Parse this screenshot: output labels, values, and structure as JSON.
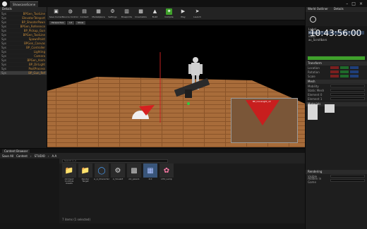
{
  "menubar": {
    "tab_label": "ShowcaseScene",
    "win_controls": [
      "–",
      "□",
      "×"
    ]
  },
  "left_panel": {
    "title": "Details",
    "rows": [
      {
        "k": "Sys",
        "v": "BPGen_ToolLine"
      },
      {
        "k": "Sys",
        "v": "ElevatorTeleport"
      },
      {
        "k": "Sys",
        "v": "BP_ShooterPawn"
      },
      {
        "k": "Sys",
        "v": "BPGen_Reference"
      },
      {
        "k": "Sys",
        "v": "BP_Pickup_Gun"
      },
      {
        "k": "Sys",
        "v": "BPGen_ToolLine"
      },
      {
        "k": "Sys",
        "v": "SpawnPoint"
      },
      {
        "k": "Sys",
        "v": "BPGen_Canvas"
      },
      {
        "k": "Sys",
        "v": "BP_Controller"
      },
      {
        "k": "Sys",
        "v": "Lighting"
      },
      {
        "k": "Sys",
        "v": "Camera"
      },
      {
        "k": "Sys",
        "v": "BPGen_Anim"
      },
      {
        "k": "Sys",
        "v": "BP_DirLight"
      },
      {
        "k": "Sys",
        "v": "PostProcess"
      },
      {
        "k": "Sys",
        "v": "BP_Gun_Ref"
      }
    ]
  },
  "toolbar": {
    "buttons": [
      {
        "icon": "save-icon",
        "glyph": "▣",
        "label": "Save Current"
      },
      {
        "icon": "source-control-icon",
        "glyph": "◍",
        "label": "Source Control"
      },
      {
        "icon": "content-icon",
        "glyph": "▤",
        "label": "Content"
      },
      {
        "icon": "marketplace-icon",
        "glyph": "▦",
        "label": "Marketplace"
      },
      {
        "icon": "settings-icon",
        "glyph": "⚙",
        "label": "Settings"
      },
      {
        "icon": "blueprints-icon",
        "glyph": "▥",
        "label": "Blueprints"
      },
      {
        "icon": "cinematics-icon",
        "glyph": "▩",
        "label": "Cinematics"
      },
      {
        "icon": "build-icon",
        "glyph": "▲",
        "label": "Build"
      },
      {
        "icon": "compile-icon",
        "glyph": "✦",
        "label": "Compile"
      },
      {
        "icon": "play-icon",
        "glyph": "▶",
        "label": "Play"
      },
      {
        "icon": "launch-icon",
        "glyph": "➤",
        "label": "Launch"
      }
    ]
  },
  "viewport": {
    "tabs": [
      "Perspective",
      "Lit",
      "Show"
    ],
    "inset_label": "BP_ConeLight_v2"
  },
  "right_panel": {
    "tabs": [
      "World Outliner",
      "Details"
    ],
    "clock": "10:43:56:00",
    "outliner": [
      "Label",
      "Material",
      "ideal",
      "ac_Scrollbars"
    ],
    "sections": [
      "Transform",
      "Mesh",
      "Materials",
      "Rendering"
    ],
    "props": [
      {
        "k": "Location"
      },
      {
        "k": "Rotation"
      },
      {
        "k": "Scale"
      },
      {
        "k": "Mobility"
      },
      {
        "k": "Static Mesh"
      },
      {
        "k": "Element 0"
      },
      {
        "k": "Element 1"
      },
      {
        "k": "Visible"
      },
      {
        "k": "Hidden in Game"
      }
    ]
  },
  "content_browser": {
    "tab": "Content Browser",
    "save_all": "Save All",
    "path": [
      "Content",
      "STUDIO",
      "A.A"
    ],
    "search_placeholder": "Search A_A",
    "assets": [
      {
        "name": "A4 Input Controls Assets",
        "glyph": "📁",
        "color": "#8b8b8b"
      },
      {
        "name": "Render Target",
        "glyph": "📁",
        "color": "#8b8b8b"
      },
      {
        "name": "A_A_Character",
        "glyph": "◯",
        "color": "#4aa3ff"
      },
      {
        "name": "A_VisualZ",
        "glyph": "⚙",
        "color": "#dddddd"
      },
      {
        "name": "A4_pawn1",
        "glyph": "▩",
        "color": "#cccccc"
      },
      {
        "name": "4.0",
        "glyph": "▦",
        "color": "#aac0ff"
      },
      {
        "name": "LH4_Lamp",
        "glyph": "✿",
        "color": "#ff7aa8"
      }
    ],
    "count_text": "7 items (1 selected)"
  }
}
